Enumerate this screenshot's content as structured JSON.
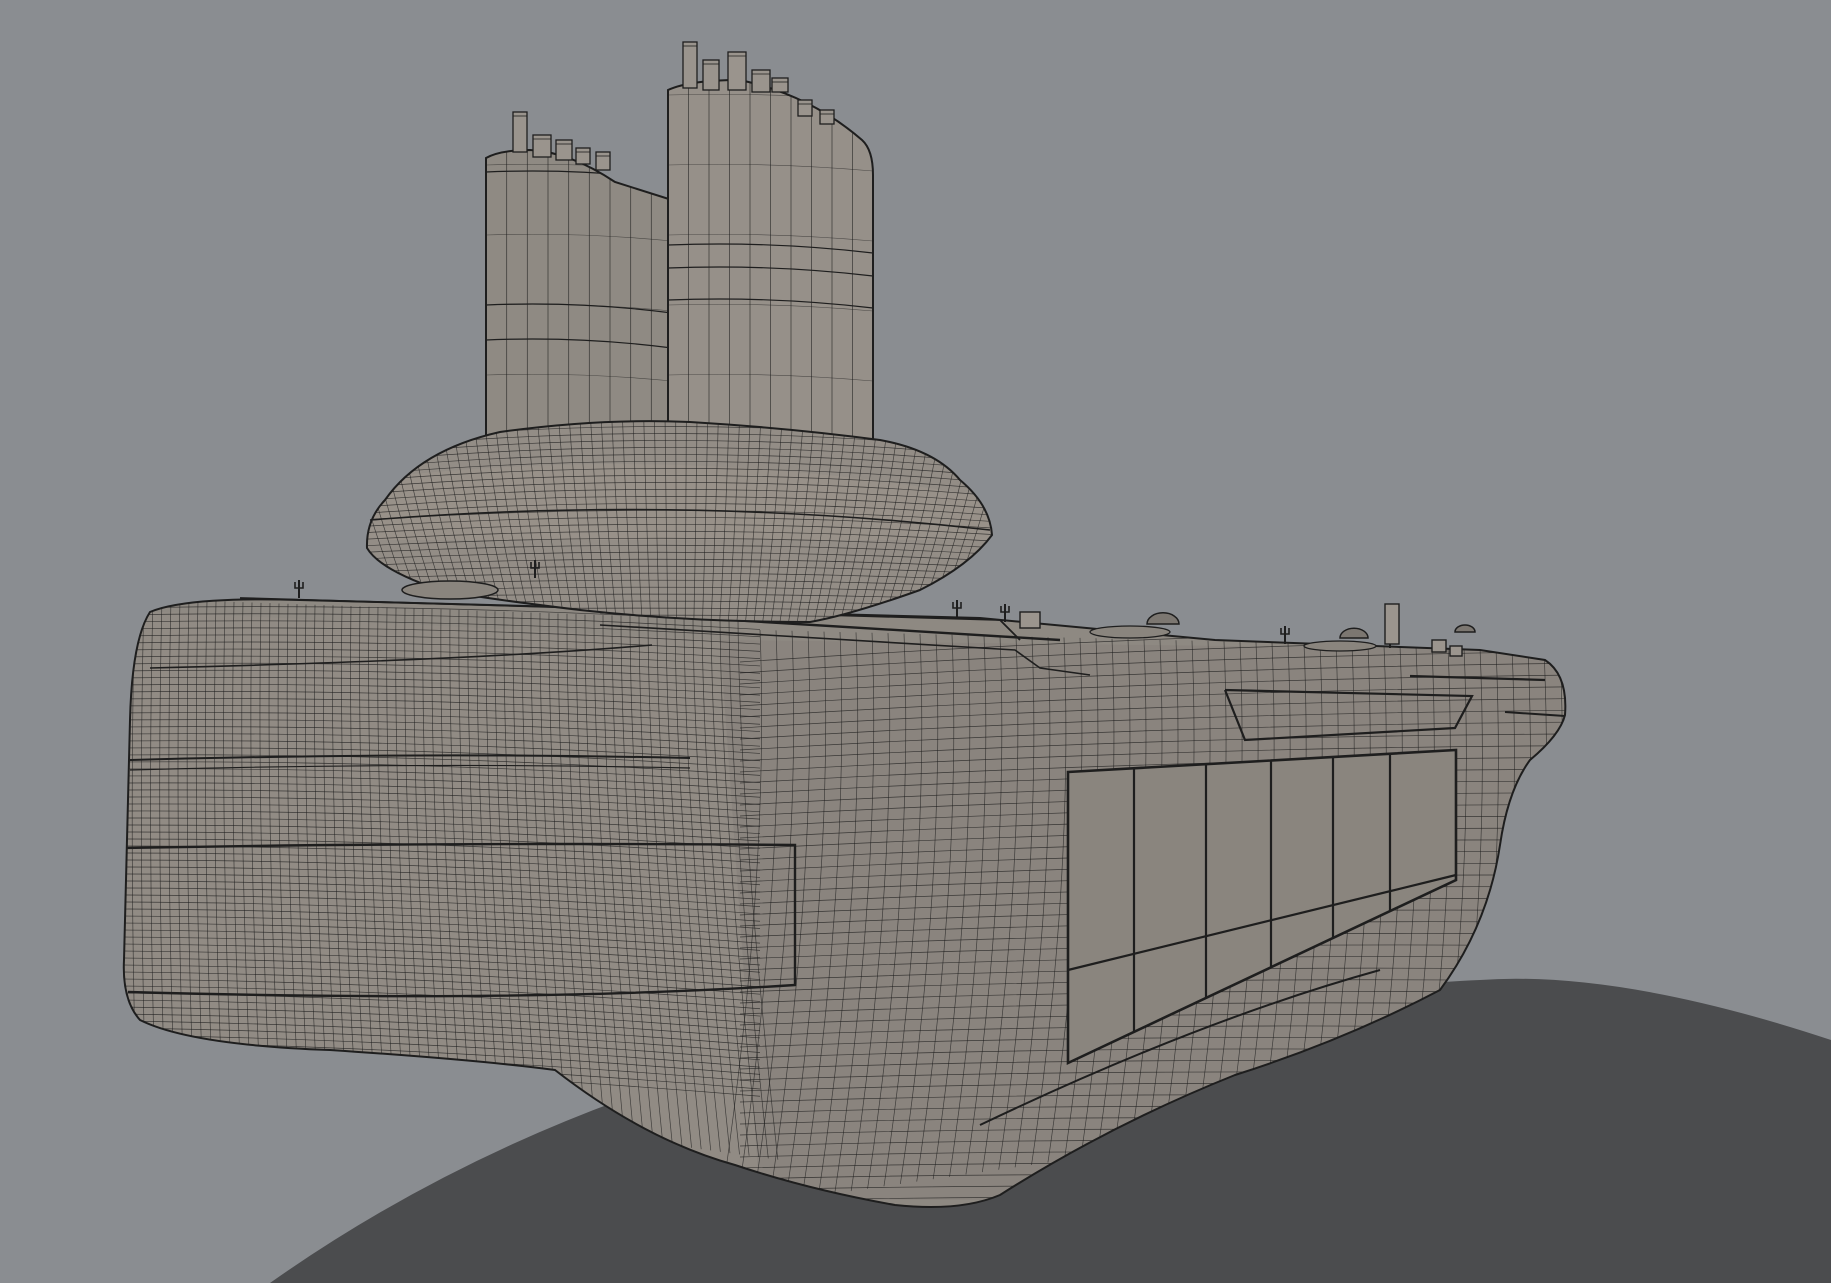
{
  "viewport": {
    "background_color": "#8a8d91",
    "ground_shadow_color": "#4b4c4e",
    "mesh_fill_color": "#8e8982",
    "mesh_fill_light_color": "#9b948c",
    "mesh_fill_dark_color": "#736f69",
    "wire_color": "#1e1e1e"
  },
  "scene": {
    "object": "wireframe-ship-hull",
    "components": [
      "ground-shadow",
      "hull",
      "bow-panel",
      "hull-windows",
      "superstructure-base",
      "funnel-left",
      "funnel-right",
      "deck-equipment"
    ]
  }
}
